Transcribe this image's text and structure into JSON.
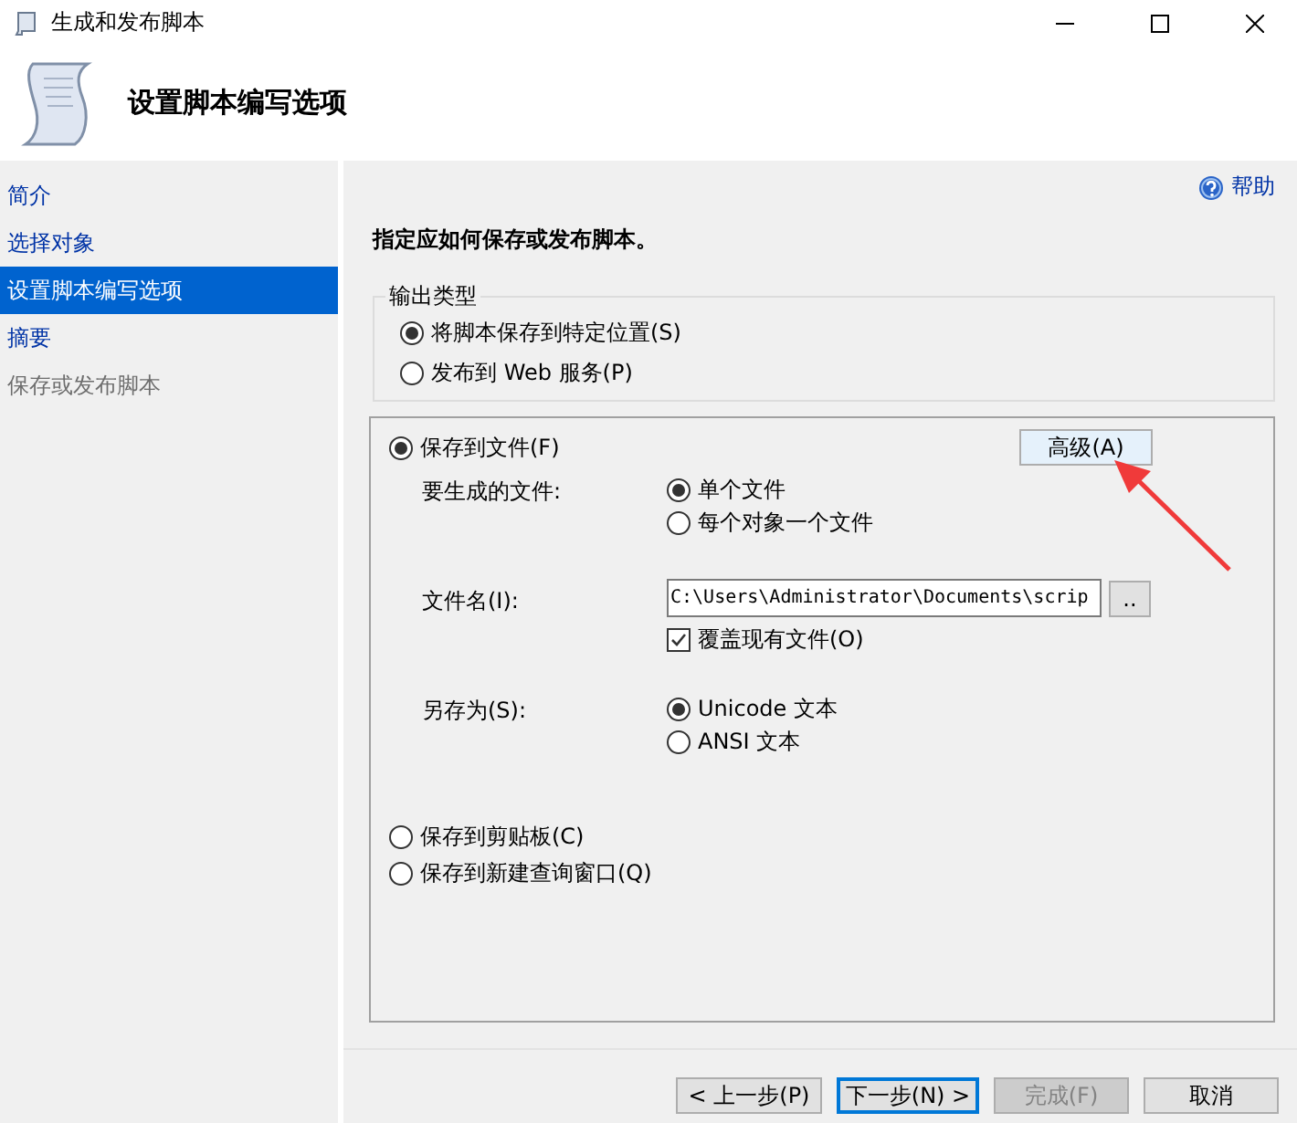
{
  "window": {
    "title": "生成和发布脚本"
  },
  "header": {
    "title": "设置脚本编写选项"
  },
  "sidebar": {
    "items": [
      {
        "label": "简介",
        "selected": false,
        "disabled": false
      },
      {
        "label": "选择对象",
        "selected": false,
        "disabled": false
      },
      {
        "label": "设置脚本编写选项",
        "selected": true,
        "disabled": false
      },
      {
        "label": "摘要",
        "selected": false,
        "disabled": false
      },
      {
        "label": "保存或发布脚本",
        "selected": false,
        "disabled": true
      }
    ]
  },
  "help": {
    "label": "帮助"
  },
  "instruction": "指定应如何保存或发布脚本。",
  "output_type": {
    "legend": "输出类型",
    "options": [
      {
        "label": "将脚本保存到特定位置(S)",
        "selected": true
      },
      {
        "label": "发布到 Web 服务(P)",
        "selected": false
      }
    ]
  },
  "destinations": [
    {
      "label": "保存到文件(F)",
      "selected": true
    },
    {
      "label": "保存到剪贴板(C)",
      "selected": false
    },
    {
      "label": "保存到新建查询窗口(Q)",
      "selected": false
    }
  ],
  "advanced_button": "高级(A)",
  "files_to_generate": {
    "label": "要生成的文件:",
    "options": [
      {
        "label": "单个文件",
        "selected": true
      },
      {
        "label": "每个对象一个文件",
        "selected": false
      }
    ]
  },
  "file_name": {
    "label": "文件名(I):",
    "value": "C:\\Users\\Administrator\\Documents\\scrip",
    "browse": "..",
    "overwrite": {
      "label": "覆盖现有文件(O)",
      "checked": true
    }
  },
  "save_as": {
    "label": "另存为(S):",
    "options": [
      {
        "label": "Unicode 文本",
        "selected": true
      },
      {
        "label": "ANSI 文本",
        "selected": false
      }
    ]
  },
  "buttons": [
    {
      "label": "< 上一步(P)",
      "disabled": false,
      "default": false
    },
    {
      "label": "下一步(N) >",
      "disabled": false,
      "default": true
    },
    {
      "label": "完成(F)",
      "disabled": true,
      "default": false
    },
    {
      "label": "取消",
      "disabled": false,
      "default": false
    }
  ]
}
